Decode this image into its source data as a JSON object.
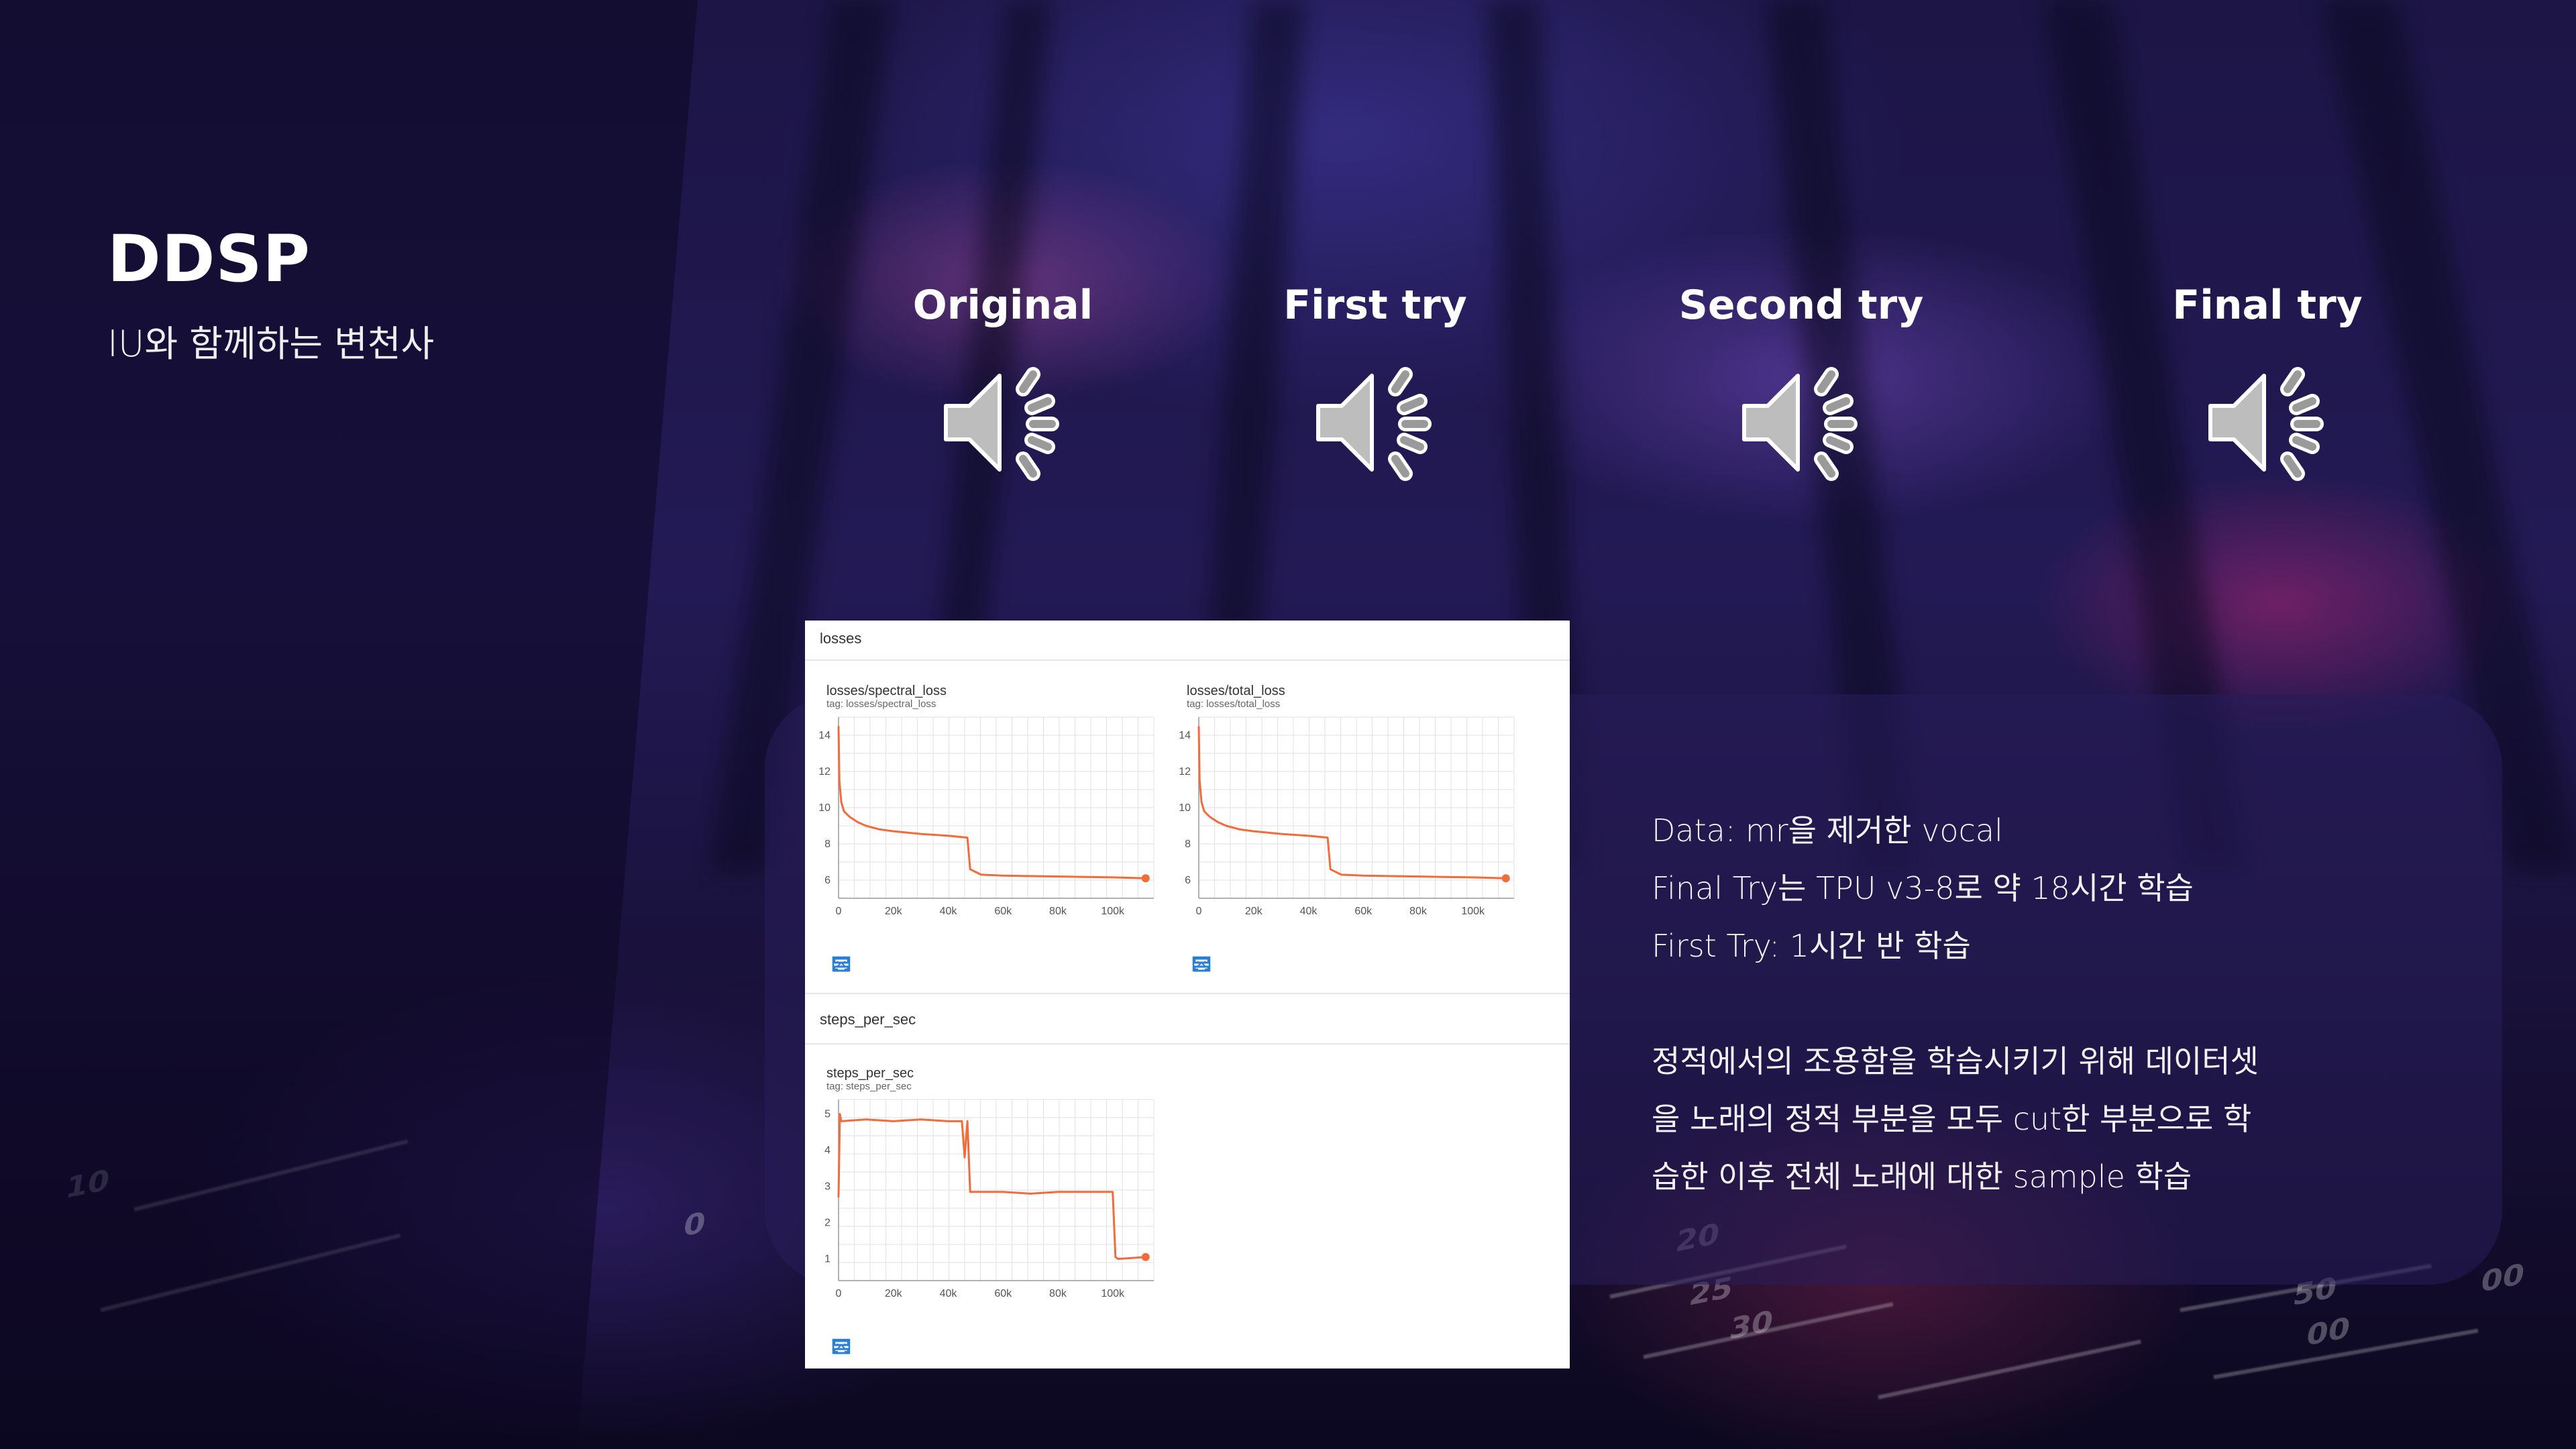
{
  "slide": {
    "title": "DDSP",
    "subtitle": "IU와 함께하는 변천사"
  },
  "audio_samples": [
    {
      "label": "Original",
      "icon": "speaker-sound-icon"
    },
    {
      "label": "First try",
      "icon": "speaker-sound-icon"
    },
    {
      "label": "Second try",
      "icon": "speaker-sound-icon"
    },
    {
      "label": "Final try",
      "icon": "speaker-sound-icon"
    }
  ],
  "notes": {
    "line1": "Data: mr을 제거한 vocal",
    "line2": "Final Try는 TPU v3-8로 약 18시간 학습",
    "line3": "First Try: 1시간 반 학습",
    "line4": "정적에서의 조용함을 학습시키기 위해 데이터셋",
    "line5": "을 노래의 정적 부분을 모두 cut한 부분으로 학",
    "line6": "습한 이후 전체 노래에 대한 sample 학습"
  },
  "tensorboard": {
    "losses_section": "losses",
    "steps_section": "steps_per_sec"
  },
  "colors": {
    "series": "#f26b3a",
    "grid": "#e2e2e2",
    "tool_icon": "#2a7fd4"
  },
  "chart_data": [
    {
      "type": "line",
      "title": "losses/spectral_loss",
      "tag": "tag: losses/spectral_loss",
      "xlim": [
        0,
        115000
      ],
      "ylim": [
        5,
        15
      ],
      "xticks": [
        0,
        20000,
        40000,
        60000,
        80000,
        100000
      ],
      "xtick_labels": [
        "0",
        "20k",
        "40k",
        "60k",
        "80k",
        "100k"
      ],
      "yticks": [
        6,
        8,
        10,
        12,
        14
      ],
      "ytick_labels": [
        "6",
        "8",
        "10",
        "12",
        "14"
      ],
      "grid": true,
      "series": [
        {
          "x": [
            0,
            300,
            1000,
            2000,
            4000,
            7000,
            10000,
            15000,
            20000,
            30000,
            40000,
            47000,
            48000,
            52000,
            60000,
            80000,
            100000,
            112000
          ],
          "y": [
            14.5,
            11.5,
            10.3,
            9.8,
            9.5,
            9.2,
            9.0,
            8.8,
            8.7,
            8.55,
            8.45,
            8.35,
            6.6,
            6.3,
            6.25,
            6.2,
            6.15,
            6.1
          ]
        }
      ]
    },
    {
      "type": "line",
      "title": "losses/total_loss",
      "tag": "tag: losses/total_loss",
      "xlim": [
        0,
        115000
      ],
      "ylim": [
        5,
        15
      ],
      "xticks": [
        0,
        20000,
        40000,
        60000,
        80000,
        100000
      ],
      "xtick_labels": [
        "0",
        "20k",
        "40k",
        "60k",
        "80k",
        "100k"
      ],
      "yticks": [
        6,
        8,
        10,
        12,
        14
      ],
      "ytick_labels": [
        "6",
        "8",
        "10",
        "12",
        "14"
      ],
      "grid": true,
      "series": [
        {
          "x": [
            0,
            300,
            1000,
            2000,
            4000,
            7000,
            10000,
            15000,
            20000,
            30000,
            40000,
            47000,
            48000,
            52000,
            60000,
            80000,
            100000,
            112000
          ],
          "y": [
            14.5,
            11.5,
            10.3,
            9.8,
            9.5,
            9.2,
            9.0,
            8.8,
            8.7,
            8.55,
            8.45,
            8.35,
            6.6,
            6.3,
            6.25,
            6.2,
            6.15,
            6.1
          ]
        }
      ]
    },
    {
      "type": "line",
      "title": "steps_per_sec",
      "tag": "tag: steps_per_sec",
      "xlim": [
        0,
        115000
      ],
      "ylim": [
        0.4,
        5.4
      ],
      "xticks": [
        0,
        20000,
        40000,
        60000,
        80000,
        100000
      ],
      "xtick_labels": [
        "0",
        "20k",
        "40k",
        "60k",
        "80k",
        "100k"
      ],
      "yticks": [
        1,
        2,
        3,
        4,
        5
      ],
      "ytick_labels": [
        "1",
        "2",
        "3",
        "4",
        "5"
      ],
      "grid": true,
      "series": [
        {
          "x": [
            0,
            500,
            1000,
            10000,
            20000,
            30000,
            40000,
            45000,
            46000,
            47000,
            48000,
            60000,
            70000,
            80000,
            100000,
            101000,
            102000,
            112000
          ],
          "y": [
            2.7,
            5.0,
            4.8,
            4.85,
            4.8,
            4.85,
            4.8,
            4.8,
            3.8,
            4.8,
            2.85,
            2.85,
            2.8,
            2.85,
            2.85,
            1.05,
            1.0,
            1.05
          ]
        }
      ]
    }
  ]
}
